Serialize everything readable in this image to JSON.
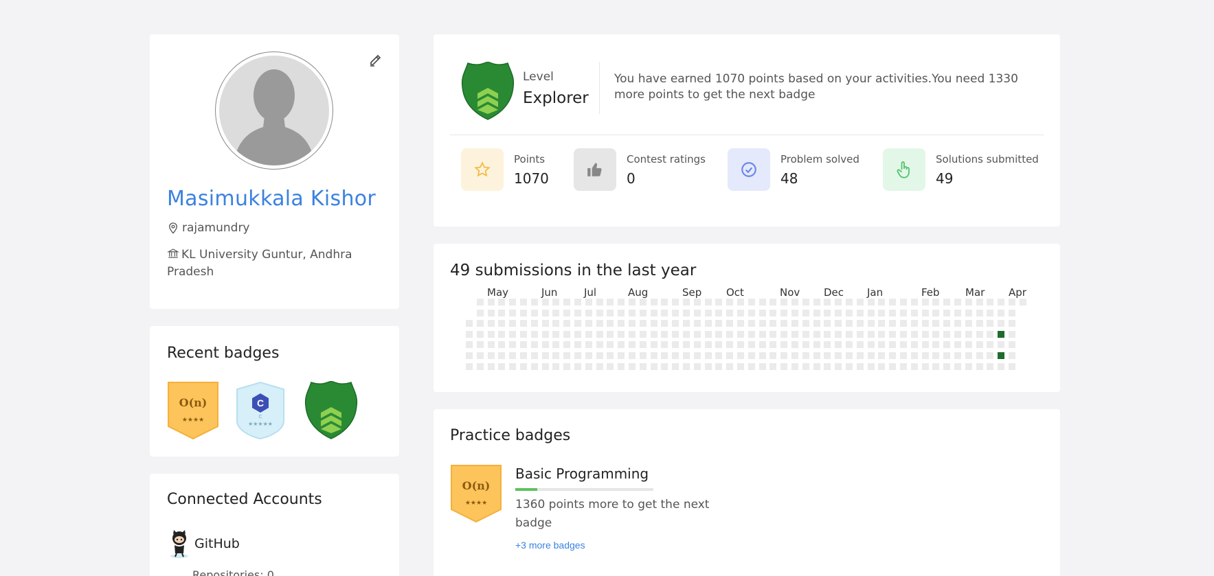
{
  "profile": {
    "name": "Masimukkala Kishor",
    "location": "rajamundry",
    "institution": "KL University Guntur, Andhra Pradesh"
  },
  "recent_badges": {
    "title": "Recent badges",
    "items": [
      {
        "name": "O(n)",
        "stars": "★★★★",
        "icon": "big-o-badge"
      },
      {
        "name": "C",
        "stars": "★★★★★",
        "icon": "c-language-badge"
      },
      {
        "name": "",
        "stars": "",
        "icon": "explorer-shield-badge"
      }
    ]
  },
  "connected": {
    "title": "Connected Accounts",
    "github_label": "GitHub",
    "repos": "Repositories: 0"
  },
  "level": {
    "label": "Level",
    "name": "Explorer",
    "message": "You have earned 1070 points based on your activities.You need 1330 more points to get the next badge"
  },
  "stats": [
    {
      "label": "Points",
      "value": "1070",
      "icon": "star-icon",
      "color": "#f5b942"
    },
    {
      "label": "Contest ratings",
      "value": "0",
      "icon": "thumbs-up-icon",
      "color": "#888888"
    },
    {
      "label": "Problem solved",
      "value": "48",
      "icon": "check-circle-icon",
      "color": "#6b86e8"
    },
    {
      "label": "Solutions submitted",
      "value": "49",
      "icon": "pointer-hand-icon",
      "color": "#4cc26a"
    }
  ],
  "heatmap": {
    "title": "49 submissions in the last year",
    "months": [
      "May",
      "Jun",
      "Jul",
      "Aug",
      "Sep",
      "Oct",
      "Nov",
      "Dec",
      "Jan",
      "Feb",
      "Mar",
      "Apr"
    ],
    "weeks": 52,
    "active_cells": [
      {
        "week": 49,
        "day": 3
      },
      {
        "week": 49,
        "day": 5
      }
    ],
    "active_color": "#1e6b2d"
  },
  "practice": {
    "title": "Practice badges",
    "badge_name": "Basic Programming",
    "badge_symbol": "O(n)",
    "badge_stars": "★★★★",
    "progress": 0.16,
    "message": "1360 points more to get the next badge",
    "more_link": "+3 more badges"
  }
}
